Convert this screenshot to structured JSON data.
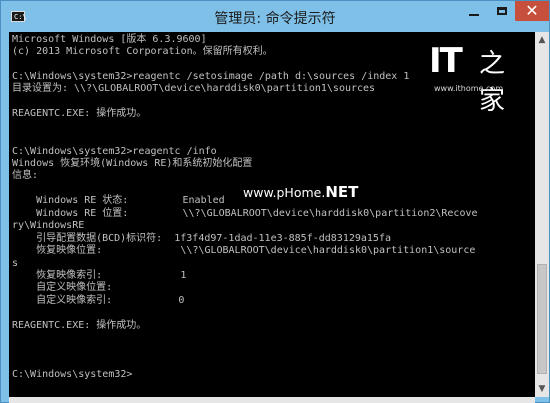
{
  "window": {
    "title": "管理员: 命令提示符",
    "icon_label": "C:\\"
  },
  "console": {
    "lines": [
      "Microsoft Windows [版本 6.3.9600]",
      "(c) 2013 Microsoft Corporation。保留所有权利。",
      "",
      "C:\\Windows\\system32>reagentc /setosimage /path d:\\sources /index 1",
      "目录设置为: \\\\?\\GLOBALROOT\\device\\harddisk0\\partition1\\sources",
      "",
      "REAGENTC.EXE: 操作成功。",
      "",
      "",
      "C:\\Windows\\system32>reagentc /info",
      "Windows 恢复环境(Windows RE)和系统初始化配置",
      "信息:",
      "",
      "    Windows RE 状态:         Enabled",
      "    Windows RE 位置:         \\\\?\\GLOBALROOT\\device\\harddisk0\\partition2\\Recove",
      "ry\\WindowsRE",
      "    引导配置数据(BCD)标识符:  1f3f4d97-1dad-11e3-885f-dd83129a15fa",
      "    恢复映像位置:             \\\\?\\GLOBALROOT\\device\\harddisk0\\partition1\\source",
      "s",
      "    恢复映像索引:             1",
      "    自定义映像位置:",
      "    自定义映像索引:           0",
      "",
      "REAGENTC.EXE: 操作成功。",
      "",
      "",
      "",
      "C:\\Windows\\system32>"
    ]
  },
  "logo": {
    "main": "IT",
    "cn": "之家",
    "url": "www.ithome.com"
  },
  "watermark": {
    "prefix": "www.pHome.",
    "suffix": "NET"
  }
}
